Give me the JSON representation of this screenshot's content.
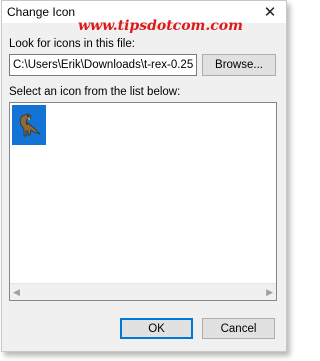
{
  "dialog": {
    "title": "Change Icon",
    "close_symbol": "✕",
    "watermark": "www.tipsdotcom.com"
  },
  "file": {
    "label": "Look for icons in this file:",
    "path_value": "C:\\Users\\Erik\\Downloads\\t-rex-0.25.",
    "browse_label": "Browse..."
  },
  "icons": {
    "label": "Select an icon from the list below:",
    "items": [
      {
        "icon": "t-rex-icon",
        "selected": true
      }
    ],
    "scroll_left": "◀",
    "scroll_right": "▶"
  },
  "buttons": {
    "ok_label": "OK",
    "cancel_label": "Cancel"
  },
  "colors": {
    "selection": "#1474d6",
    "watermark": "#dd1a1a",
    "default_button_border": "#0078d7"
  }
}
